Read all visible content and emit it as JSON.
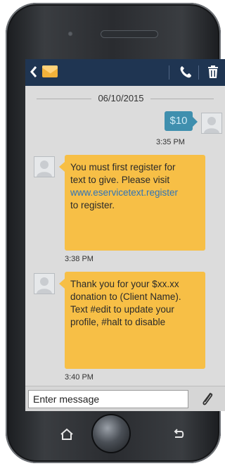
{
  "conversation": {
    "date": "06/10/2015",
    "messages": [
      {
        "direction": "outgoing",
        "text": "$10",
        "time": "3:35 PM"
      },
      {
        "direction": "incoming",
        "lines": [
          "You must first register for",
          "text to give. Please visit"
        ],
        "link": "www.eservicetext.register",
        "after_link": "to register.",
        "time": "3:38 PM"
      },
      {
        "direction": "incoming",
        "lines": [
          "Thank you for your $xx.xx",
          "donation to (Client Name).",
          "Text #edit to update your",
          "profile, #halt to disable"
        ],
        "time": "3:40 PM"
      }
    ]
  },
  "composer": {
    "placeholder": "Enter message"
  },
  "header": {
    "back_icon": "chevron-left-icon",
    "app_icon": "envelope-icon",
    "call_icon": "phone-icon",
    "delete_icon": "trash-icon"
  },
  "navigation": {
    "left_icon": "home-icon",
    "right_icon": "back-icon"
  },
  "colors": {
    "header_bg": "#1f3552",
    "outgoing_bubble": "#3f8fae",
    "incoming_bubble": "#f7bf46",
    "link": "#2f74b8",
    "screen_bg": "#dcdcdc"
  }
}
